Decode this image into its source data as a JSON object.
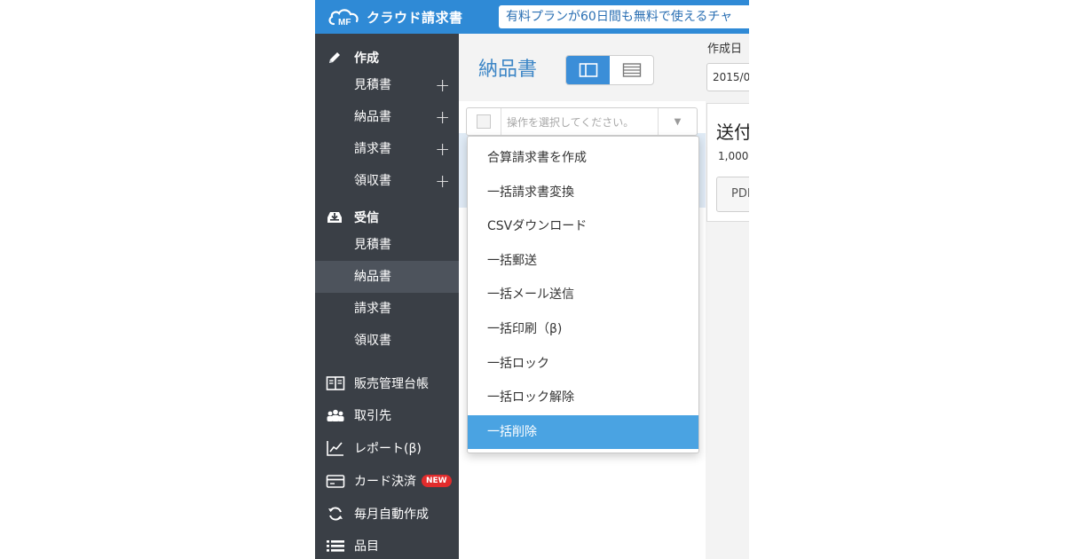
{
  "app": {
    "logo_mark": "MF",
    "logo_text": "クラウド請求書"
  },
  "promo_text": "有料プランが60日間も無料で使えるチャ",
  "sidebar": {
    "create": {
      "label": "作成",
      "icon": "pencil-icon",
      "items": [
        {
          "label": "見積書",
          "add": "+"
        },
        {
          "label": "納品書",
          "add": "+"
        },
        {
          "label": "請求書",
          "add": "+"
        },
        {
          "label": "領収書",
          "add": "+"
        }
      ]
    },
    "receive": {
      "label": "受信",
      "icon": "inbox-download-icon",
      "items": [
        {
          "label": "見積書"
        },
        {
          "label": "納品書",
          "active": true
        },
        {
          "label": "請求書"
        },
        {
          "label": "領収書"
        }
      ]
    },
    "nav": [
      {
        "label": "販売管理台帳",
        "icon": "book-icon"
      },
      {
        "label": "取引先",
        "icon": "people-icon"
      },
      {
        "label": "レポート(β)",
        "icon": "chart-icon"
      },
      {
        "label": "カード決済",
        "icon": "credit-card-icon",
        "badge": "NEW"
      },
      {
        "label": "毎月自動作成",
        "icon": "sync-icon"
      },
      {
        "label": "品目",
        "icon": "list-icon"
      }
    ]
  },
  "main": {
    "title": "納品書",
    "view_toggle": {
      "active": "split-view"
    },
    "selector": {
      "placeholder": "操作を選択してください。"
    },
    "dropdown": {
      "items": [
        "合算請求書を作成",
        "一括請求書変換",
        "CSVダウンロード",
        "一括郵送",
        "一括メール送信",
        "一括印刷（β)",
        "一括ロック",
        "一括ロック解除",
        "一括削除"
      ],
      "selected_index": 8
    }
  },
  "right": {
    "date_label": "作成日",
    "date_value": "2015/0",
    "detail_title": "送付",
    "amount": "1,000",
    "pdf_label": "PDF"
  },
  "colors": {
    "brand": "#2f8ad6",
    "sidebar": "#3a3f46",
    "selected": "#4aa3e2",
    "badge": "#e12c2c"
  }
}
